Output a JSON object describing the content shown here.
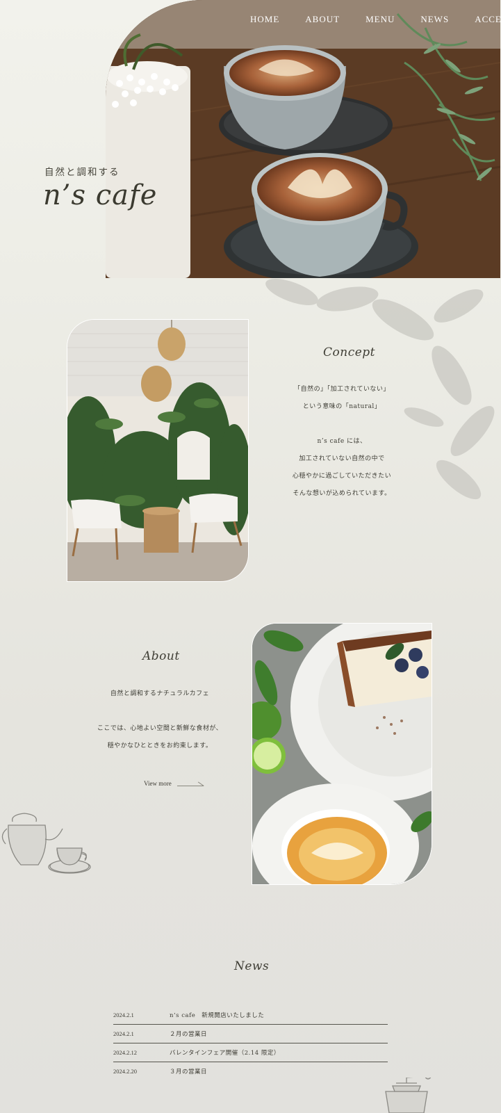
{
  "nav": {
    "items": [
      "HOME",
      "ABOUT",
      "MENU",
      "NEWS",
      "ACCESS"
    ]
  },
  "hero": {
    "tagline": "自然と調和する",
    "logo": "n’s cafe"
  },
  "concept": {
    "title": "Concept",
    "lines": [
      "「自然の」「加工されていない」",
      "という意味の「natural」",
      "",
      "n’s cafe には、",
      "加工されていない自然の中で",
      "心穏やかに過ごしていただきたい",
      "そんな想いが込められています。"
    ]
  },
  "about": {
    "title": "About",
    "lines": [
      "自然と調和するナチュラルカフェ",
      "",
      "ここでは、心地よい空間と新鮮な食材が、",
      "穏やかなひとときをお約束します。"
    ],
    "view_more": "View more"
  },
  "news": {
    "title": "News",
    "items": [
      {
        "date": "2024.2.1",
        "title": "n’s cafe　新規開店いたしました"
      },
      {
        "date": "2024.2.1",
        "title": "２月の営業日"
      },
      {
        "date": "2024.2.12",
        "title": "バレンタインフェア開催（2.14 限定）"
      },
      {
        "date": "2024.2.20",
        "title": "３月の営業日"
      }
    ]
  },
  "colors": {
    "background": "#ecebe5",
    "text": "#3b3a32",
    "divider": "#55544c"
  },
  "icons": [
    "coffee-kettle-illustration-icon",
    "coffee-cup-illustration-icon",
    "coffee-grinder-illustration-icon",
    "arrow-right-icon"
  ]
}
